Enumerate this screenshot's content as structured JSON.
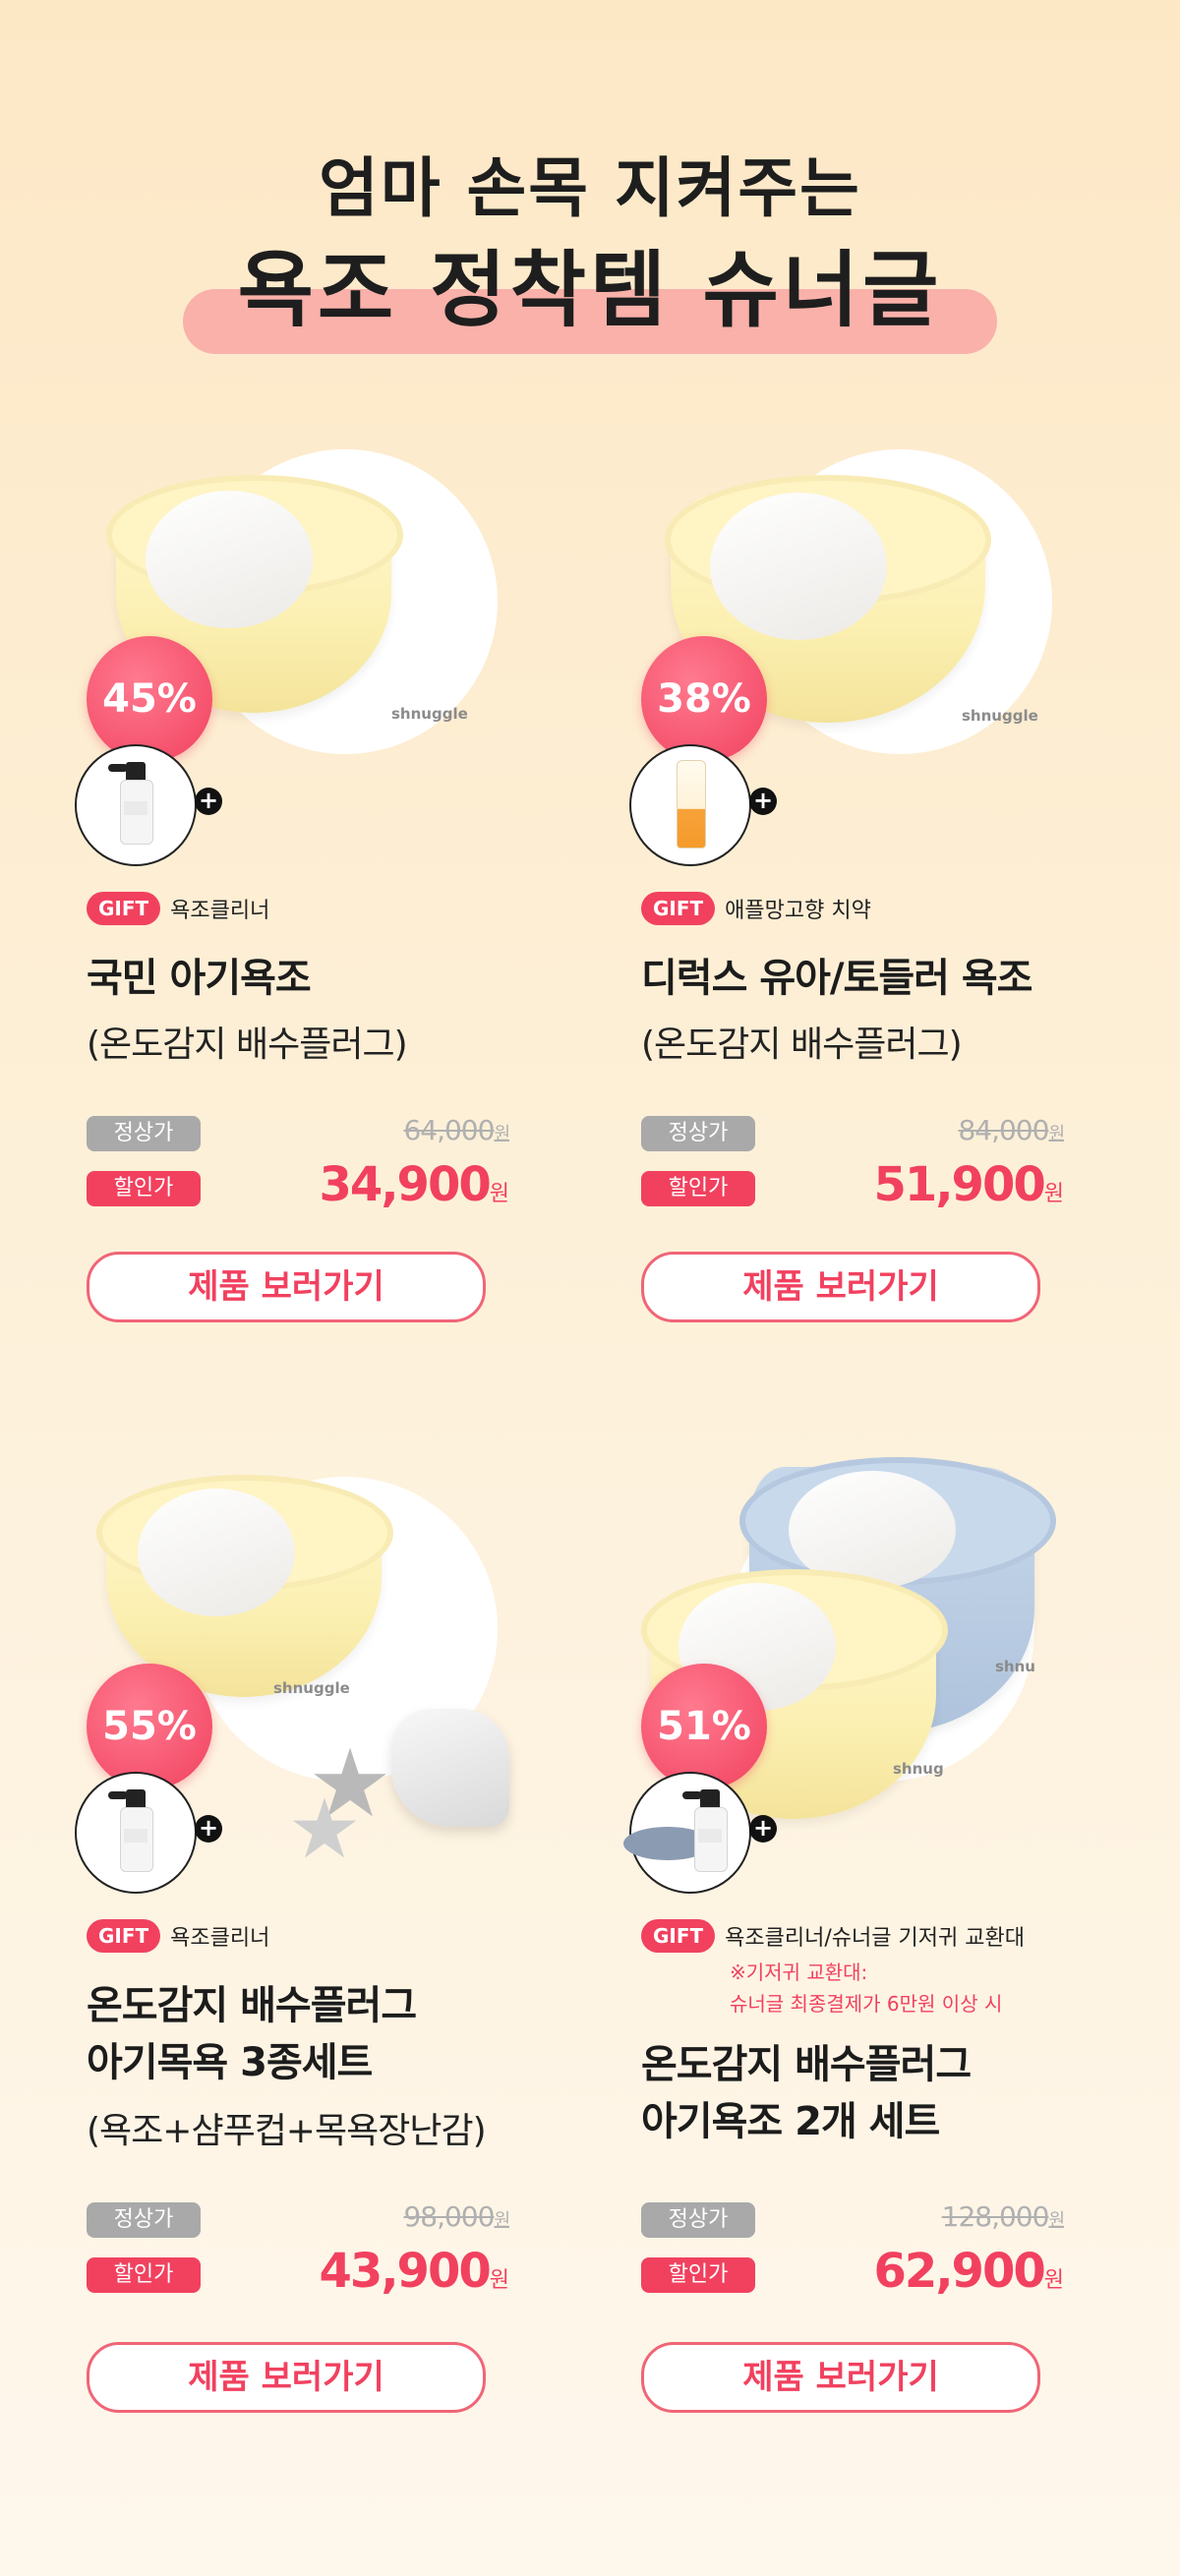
{
  "header": {
    "subtitle": "엄마 손목 지켜주는",
    "title": "욕조 정착템 슈너글"
  },
  "colors": {
    "accent": "#f1415f",
    "highlight_bar": "#f8a7a4",
    "background": "#fde8c6"
  },
  "products": [
    {
      "discount": "45%",
      "gift_icon": "bathtub-cleaner-bottle-icon",
      "gift_label": "GIFT",
      "gift_text": "욕조클리너",
      "gift_note_1": "",
      "gift_note_2": "",
      "title_1": "국민 아기욕조",
      "title_2": "",
      "subtitle": "(온도감지 배수플러그)",
      "regular_label": "정상가",
      "regular_price": "64,000",
      "sale_label": "할인가",
      "sale_price": "34,900",
      "currency": "원",
      "button": "제품 보러가기",
      "brand": "shnuggle"
    },
    {
      "discount": "38%",
      "gift_icon": "toothpaste-tube-icon",
      "gift_label": "GIFT",
      "gift_text": "애플망고향 치약",
      "gift_note_1": "",
      "gift_note_2": "",
      "title_1": "디럭스 유아/토들러 욕조",
      "title_2": "",
      "subtitle": "(온도감지 배수플러그)",
      "regular_label": "정상가",
      "regular_price": "84,000",
      "sale_label": "할인가",
      "sale_price": "51,900",
      "currency": "원",
      "button": "제품 보러가기",
      "brand": "shnuggle"
    },
    {
      "discount": "55%",
      "gift_icon": "bathtub-cleaner-bottle-icon",
      "gift_label": "GIFT",
      "gift_text": "욕조클리너",
      "gift_note_1": "",
      "gift_note_2": "",
      "title_1": "온도감지 배수플러그",
      "title_2": "아기목욕 3종세트",
      "subtitle": "(욕조+샴푸컵+목욕장난감)",
      "regular_label": "정상가",
      "regular_price": "98,000",
      "sale_label": "할인가",
      "sale_price": "43,900",
      "currency": "원",
      "button": "제품 보러가기",
      "brand": "shnuggle"
    },
    {
      "discount": "51%",
      "gift_icon": "bathtub-cleaner-and-changing-pad-icon",
      "gift_label": "GIFT",
      "gift_text": "욕조클리너/슈너글 기저귀 교환대",
      "gift_note_1": "※기저귀 교환대:",
      "gift_note_2": "슈너글 최종결제가 6만원 이상 시",
      "title_1": "온도감지 배수플러그",
      "title_2": "아기욕조 2개 세트",
      "subtitle": "",
      "regular_label": "정상가",
      "regular_price": "128,000",
      "sale_label": "할인가",
      "sale_price": "62,900",
      "currency": "원",
      "button": "제품 보러가기",
      "brand": "shnug"
    }
  ]
}
